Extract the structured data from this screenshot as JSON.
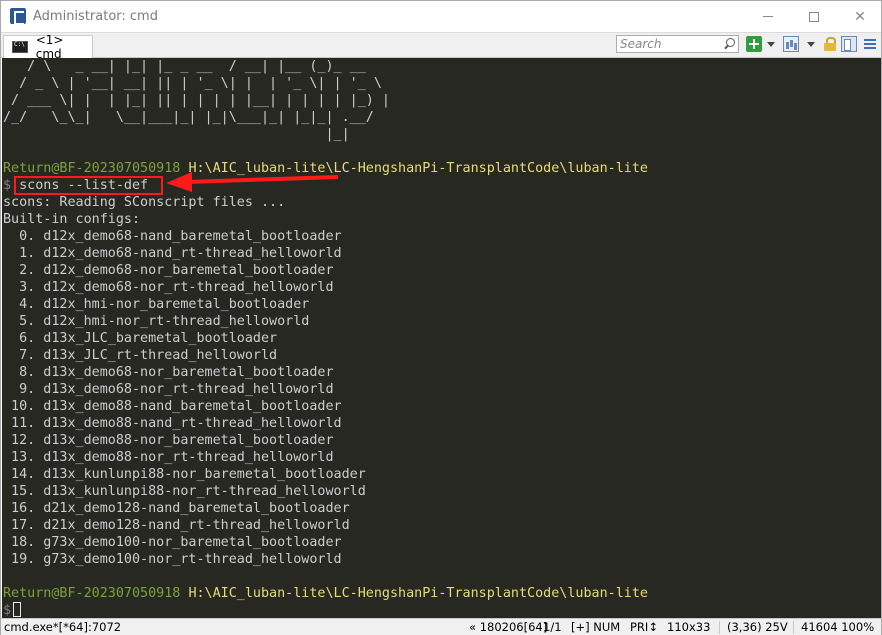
{
  "window": {
    "title": "Administrator: cmd"
  },
  "tabs": [
    {
      "label": "<1> cmd"
    }
  ],
  "search": {
    "placeholder": "Search"
  },
  "console": {
    "ascii_art": [
      "   / \\   _ __| |_| |_ _ __  / __| |__ (_)_ __",
      "  / _ \\ | '__| __| || | '_ \\| |  | '_ \\| | '_ \\",
      " / ___ \\| |  | |_| || | | | | |__| | | | | |_) |",
      "/_/   \\_\\_|   \\__|___|_| |_|\\___|_| |_|_| .__/",
      "                                        |_|"
    ],
    "prompt_user": "Return@BF-202307050918",
    "prompt_path": "H:\\AIC_luban-lite\\LC-HengshanPi-TransplantCode\\luban-lite",
    "dollar": "$",
    "command": "scons --list-def",
    "output_header": [
      "scons: Reading SConscript files ...",
      "Built-in configs:"
    ],
    "configs": [
      "  0. d12x_demo68-nand_baremetal_bootloader",
      "  1. d12x_demo68-nand_rt-thread_helloworld",
      "  2. d12x_demo68-nor_baremetal_bootloader",
      "  3. d12x_demo68-nor_rt-thread_helloworld",
      "  4. d12x_hmi-nor_baremetal_bootloader",
      "  5. d12x_hmi-nor_rt-thread_helloworld",
      "  6. d13x_JLC_baremetal_bootloader",
      "  7. d13x_JLC_rt-thread_helloworld",
      "  8. d13x_demo68-nor_baremetal_bootloader",
      "  9. d13x_demo68-nor_rt-thread_helloworld",
      " 10. d13x_demo88-nand_baremetal_bootloader",
      " 11. d13x_demo88-nand_rt-thread_helloworld",
      " 12. d13x_demo88-nor_baremetal_bootloader",
      " 13. d13x_demo88-nor_rt-thread_helloworld",
      " 14. d13x_kunlunpi88-nor_baremetal_bootloader",
      " 15. d13x_kunlunpi88-nor_rt-thread_helloworld",
      " 16. d21x_demo128-nand_baremetal_bootloader",
      " 17. d21x_demo128-nand_rt-thread_helloworld",
      " 18. g73x_demo100-nor_baremetal_bootloader",
      " 19. g73x_demo100-nor_rt-thread_helloworld"
    ]
  },
  "statusbar": {
    "process": "cmd.exe*[*64]:7072",
    "position": "« 180206[64]",
    "pages": "1/1",
    "insert": "[+] NUM",
    "priority": "PRI↕",
    "size": "110x33",
    "cursor": "(3,36) 25V",
    "pid_zoom": "41604 100%"
  },
  "colors": {
    "console_bg": "#272822",
    "prompt_user": "#7ea13a",
    "prompt_path": "#e6db74",
    "highlight": "#ff1a1a"
  }
}
